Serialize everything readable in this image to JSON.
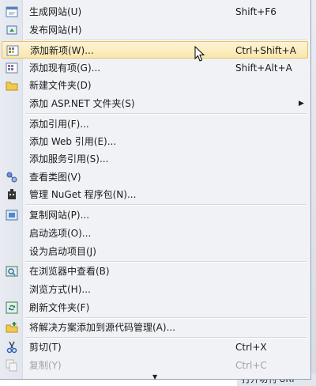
{
  "menu": {
    "items": [
      {
        "label": "生成网站(U)",
        "shortcut": "Shift+F6",
        "icon": "build-website-icon"
      },
      {
        "label": "发布网站(H)",
        "shortcut": "",
        "icon": "publish-website-icon"
      },
      {
        "label": "添加新项(W)...",
        "shortcut": "Ctrl+Shift+A",
        "icon": "add-new-item-icon"
      },
      {
        "label": "添加现有项(G)...",
        "shortcut": "Shift+Alt+A",
        "icon": "add-existing-item-icon"
      },
      {
        "label": "新建文件夹(D)",
        "shortcut": "",
        "icon": "new-folder-icon"
      },
      {
        "label": "添加 ASP.NET 文件夹(S)",
        "shortcut": "",
        "icon": ""
      },
      {
        "label": "添加引用(F)...",
        "shortcut": "",
        "icon": ""
      },
      {
        "label": "添加 Web 引用(E)...",
        "shortcut": "",
        "icon": ""
      },
      {
        "label": "添加服务引用(S)...",
        "shortcut": "",
        "icon": ""
      },
      {
        "label": "查看类图(V)",
        "shortcut": "",
        "icon": "class-diagram-icon"
      },
      {
        "label": "管理 NuGet 程序包(N)...",
        "shortcut": "",
        "icon": "nuget-icon"
      },
      {
        "label": "复制网站(P)...",
        "shortcut": "",
        "icon": "copy-website-icon"
      },
      {
        "label": "启动选项(O)...",
        "shortcut": "",
        "icon": ""
      },
      {
        "label": "设为启动项目(J)",
        "shortcut": "",
        "icon": ""
      },
      {
        "label": "在浏览器中查看(B)",
        "shortcut": "",
        "icon": "view-in-browser-icon"
      },
      {
        "label": "浏览方式(H)...",
        "shortcut": "",
        "icon": ""
      },
      {
        "label": "刷新文件夹(F)",
        "shortcut": "",
        "icon": "refresh-folder-icon"
      },
      {
        "label": "将解决方案添加到源代码管理(A)...",
        "shortcut": "",
        "icon": "source-control-icon"
      },
      {
        "label": "剪切(T)",
        "shortcut": "Ctrl+X",
        "icon": "cut-icon"
      },
      {
        "label": "复制(Y)",
        "shortcut": "Ctrl+C",
        "icon": "copy-icon"
      }
    ],
    "highlight_color": "#fae7ae"
  },
  "background": {
    "bottom_text": "打开切刊 URI"
  }
}
